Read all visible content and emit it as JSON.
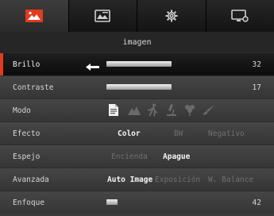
{
  "tabs": [
    {
      "icon": "image-icon"
    },
    {
      "icon": "display-settings-icon"
    },
    {
      "icon": "gear-icon"
    },
    {
      "icon": "monitor-icon"
    }
  ],
  "accent": "#e23b1e",
  "section_title": "imagen",
  "rows": {
    "brillo": {
      "label": "Brillo",
      "value": "32"
    },
    "contraste": {
      "label": "Contraste",
      "value": "17"
    },
    "modo": {
      "label": "Modo",
      "icons": [
        "document-icon",
        "mountain-icon",
        "sports-icon",
        "microscope-icon",
        "flower-icon",
        "paint-icon"
      ]
    },
    "efecto": {
      "label": "Efecto",
      "options": [
        "Color",
        "BW",
        "Negativo"
      ],
      "selected": "Color"
    },
    "espejo": {
      "label": "Espejo",
      "options": [
        "Encienda",
        "Apague"
      ],
      "selected": "Apague"
    },
    "avanzada": {
      "label": "Avanzada",
      "options": [
        "Auto Image",
        "Exposición",
        "W. Balance"
      ],
      "selected": "Auto Image"
    },
    "enfoque": {
      "label": "Enfoque",
      "value": "42"
    }
  }
}
